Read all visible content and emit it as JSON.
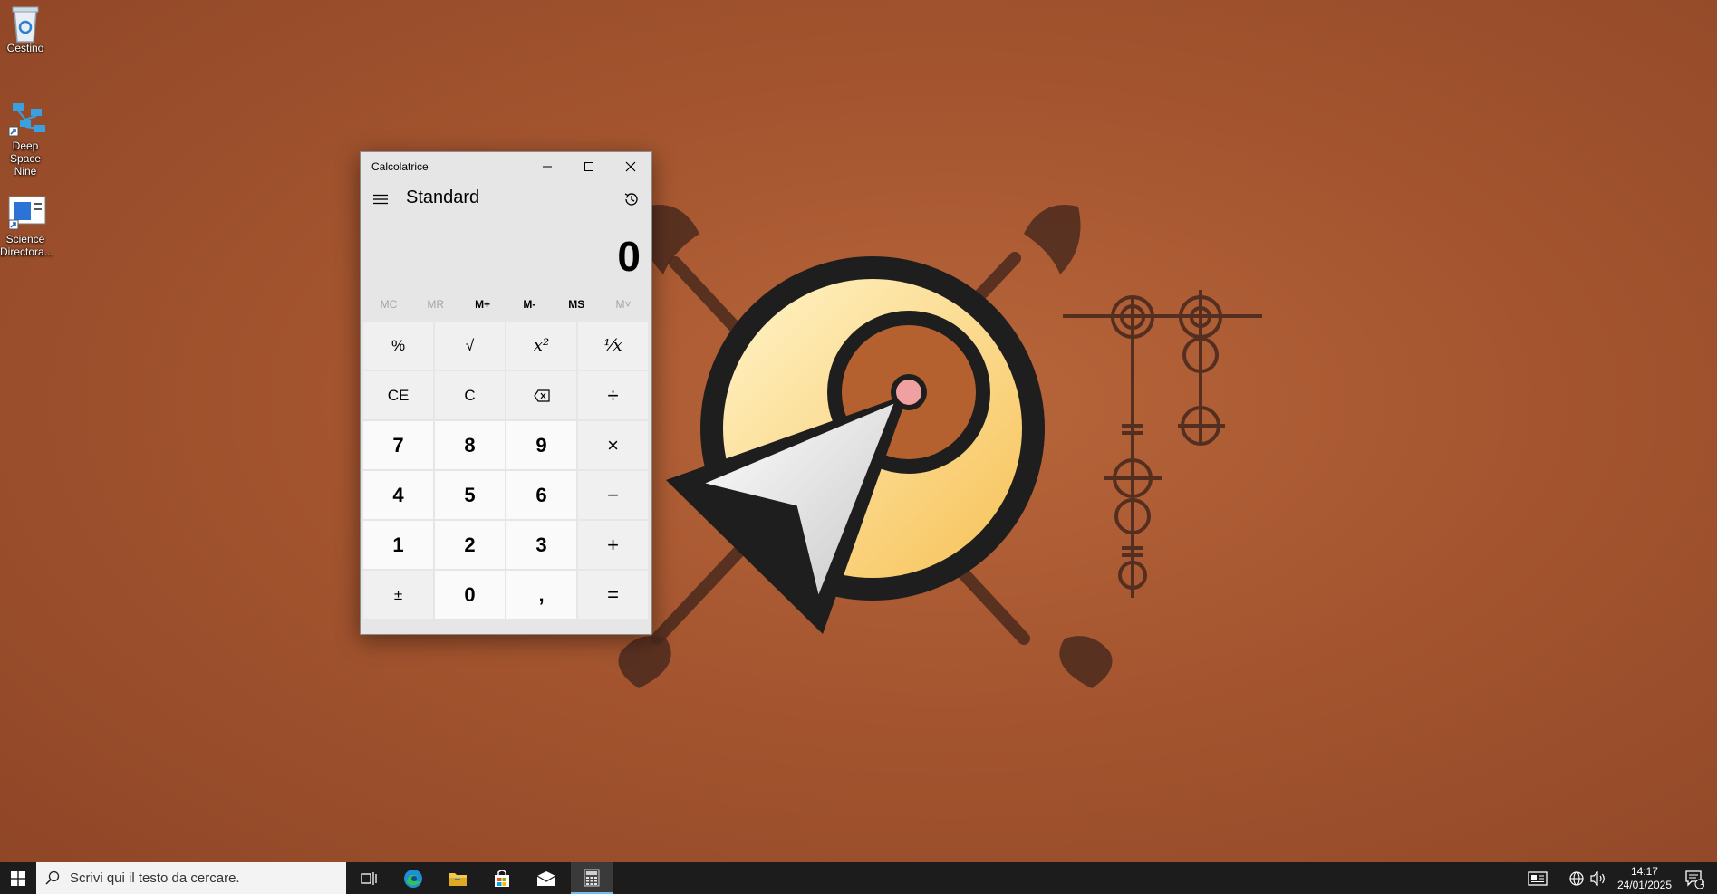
{
  "desktop": {
    "icons": [
      {
        "label": "Cestino",
        "icon": "recycle-bin-icon"
      },
      {
        "label": "Deep Space Nine",
        "icon": "network-shortcut-icon"
      },
      {
        "label": "Science Directora...",
        "icon": "app-shortcut-icon"
      }
    ]
  },
  "calculator": {
    "window_title": "Calcolatrice",
    "mode": "Standard",
    "display_value": "0",
    "memory": [
      {
        "label": "MC",
        "enabled": false
      },
      {
        "label": "MR",
        "enabled": false
      },
      {
        "label": "M+",
        "enabled": true
      },
      {
        "label": "M-",
        "enabled": true
      },
      {
        "label": "MS",
        "enabled": true
      },
      {
        "label": "M˅",
        "enabled": false
      }
    ],
    "keys": {
      "percent": "%",
      "sqrt": "√",
      "square": "x²",
      "reciprocal": "⅟x",
      "ce": "CE",
      "c": "C",
      "backspace": "⌫",
      "divide": "÷",
      "seven": "7",
      "eight": "8",
      "nine": "9",
      "multiply": "×",
      "four": "4",
      "five": "5",
      "six": "6",
      "minus": "−",
      "one": "1",
      "two": "2",
      "three": "3",
      "plus": "+",
      "negate": "±",
      "zero": "0",
      "decimal": ",",
      "equals": "="
    }
  },
  "taskbar": {
    "search_placeholder": "Scrivi qui il testo da cercare.",
    "time": "14:17",
    "date": "24/01/2025",
    "notification_count": "1",
    "accent": "#76b9ed"
  }
}
